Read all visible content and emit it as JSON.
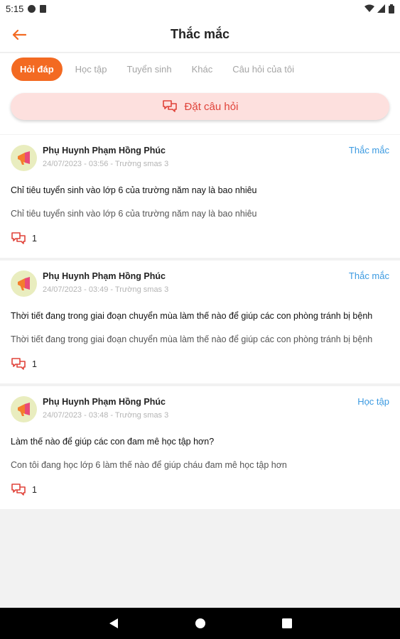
{
  "status_bar": {
    "time": "5:15"
  },
  "header": {
    "title": "Thắc mắc"
  },
  "tabs": [
    {
      "label": "Hỏi đáp",
      "active": true
    },
    {
      "label": "Học tập",
      "active": false
    },
    {
      "label": "Tuyển sinh",
      "active": false
    },
    {
      "label": "Khác",
      "active": false
    },
    {
      "label": "Câu hỏi của tôi",
      "active": false
    }
  ],
  "ask_button": {
    "label": "Đặt câu hỏi"
  },
  "questions": [
    {
      "author": "Phụ Huynh Phạm Hồng Phúc",
      "subline": "24/07/2023 - 03:56 - Trường smas 3",
      "category": "Thắc mắc",
      "title": "Chỉ tiêu tuyển sinh vào lớp 6 của trường năm nay là bao nhiêu",
      "body": "Chỉ tiêu tuyển sinh vào lớp 6 của trường năm nay là bao nhiêu",
      "comment_count": "1"
    },
    {
      "author": "Phụ Huynh Phạm Hồng Phúc",
      "subline": "24/07/2023 - 03:49 - Trường smas 3",
      "category": "Thắc mắc",
      "title": "Thời tiết đang trong giai đoạn chuyển mùa làm thế nào để giúp các con phòng tránh bị bệnh",
      "body": "Thời tiết đang trong giai đoạn chuyển mùa làm thế nào để giúp các con phòng tránh bị bệnh",
      "comment_count": "1"
    },
    {
      "author": "Phụ Huynh Phạm Hồng Phúc",
      "subline": "24/07/2023 - 03:48 - Trường smas 3",
      "category": "Học tập",
      "title": "Làm thế nào để giúp các con đam mê học tập hơn?",
      "body": "Con tôi đang học lớp 6 làm thế nào để giúp cháu đam mê học tập hơn",
      "comment_count": "1"
    }
  ],
  "icons": {
    "back": "arrow-left-icon",
    "ask": "chat-bubbles-icon",
    "comment": "chat-bubbles-icon",
    "avatar": "megaphone-icon",
    "nav_back": "triangle-back-icon",
    "nav_home": "circle-home-icon",
    "nav_recents": "square-recents-icon"
  },
  "colors": {
    "accent": "#f36a22",
    "danger": "#e0433a",
    "ask_bg": "#fde0de",
    "link": "#3b9ae1"
  }
}
